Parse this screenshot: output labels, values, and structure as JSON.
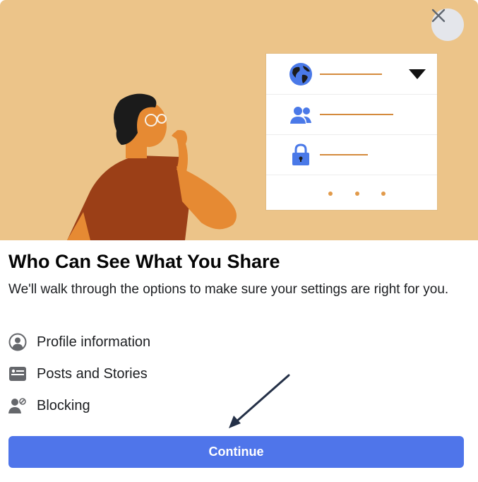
{
  "dialog": {
    "title": "Who Can See What You Share",
    "subtitle": "We'll walk through the options to make sure your settings are right for you.",
    "close_icon": "close-icon",
    "options": [
      {
        "label": "Profile information",
        "icon": "profile-icon"
      },
      {
        "label": "Posts and Stories",
        "icon": "posts-icon"
      },
      {
        "label": "Blocking",
        "icon": "blocking-icon"
      }
    ],
    "continue_label": "Continue"
  },
  "illustration": {
    "card_rows": [
      {
        "icon": "globe-icon"
      },
      {
        "icon": "friends-icon"
      },
      {
        "icon": "lock-icon"
      }
    ]
  },
  "colors": {
    "hero_background": "#ecc489",
    "primary_button": "#4f75ea",
    "accent_blue": "#4a79e8",
    "line_orange": "#d48a3c"
  }
}
